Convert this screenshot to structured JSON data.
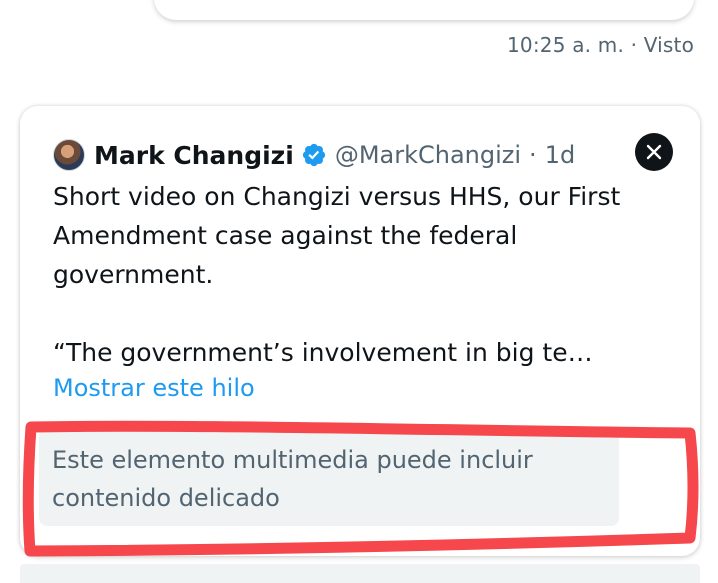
{
  "previous_message": {
    "time": "10:25 a. m.",
    "separator": "·",
    "status": "Visto"
  },
  "tweet": {
    "author_name": "Mark Changizi",
    "handle": "@MarkChangizi",
    "separator": "·",
    "time": "1d",
    "verified_icon": "verified-badge-icon",
    "text": "Short video on Changizi versus HHS, our First Amendment case against the federal government.\n\n“The government’s involvement in big te…",
    "show_thread": "Mostrar este hilo",
    "sensitive_media": "Este elemento multimedia puede incluir contenido delicado"
  },
  "icons": {
    "close": "close-icon"
  },
  "colors": {
    "verified": "#1d9bf0",
    "link": "#1d9bf0",
    "highlight": "#f5474c",
    "secondary_text": "#536471"
  }
}
